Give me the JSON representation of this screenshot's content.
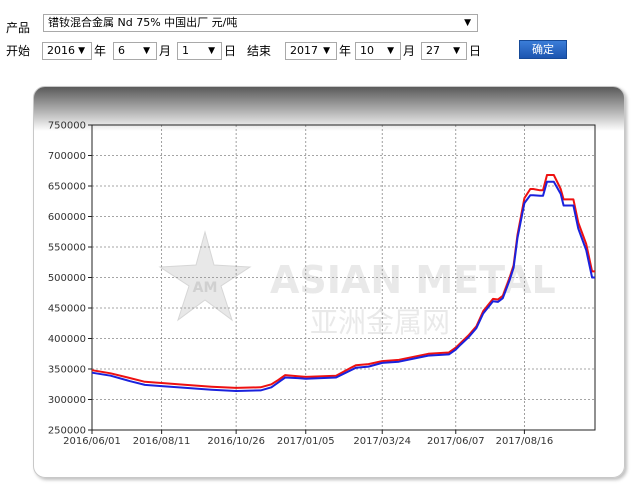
{
  "form": {
    "product_label": "产品",
    "product_value": "镨钕混合金属  Nd 75% 中国出厂  元/吨",
    "start_label": "开始",
    "start_year": "2016",
    "year_unit": "年",
    "start_month": "6",
    "month_unit": "月",
    "start_day": "1",
    "day_unit": "日",
    "end_label": "结束",
    "end_year": "2017",
    "end_month": "10",
    "end_day": "27",
    "confirm_button": "确定"
  },
  "watermark": {
    "logo_text": "AM",
    "brand_en": "ASIAN METAL",
    "brand_cn": "亚洲金属网"
  },
  "colors": {
    "series_red": "#ee1111",
    "series_blue": "#1a22dd",
    "button": "#2563c4"
  },
  "chart_data": {
    "type": "line",
    "ylim": [
      250000,
      750000
    ],
    "yticks": [
      250000,
      300000,
      350000,
      400000,
      450000,
      500000,
      550000,
      600000,
      650000,
      700000,
      750000
    ],
    "yticklabels": [
      "250000",
      "300000",
      "350000",
      "400000",
      "450000",
      "500000",
      "550000",
      "600000",
      "650000",
      "700000",
      "750000"
    ],
    "xlim": [
      "2016-06-01",
      "2017-10-27"
    ],
    "xticks": [
      "2016-06-01",
      "2016-08-11",
      "2016-10-26",
      "2017-01-05",
      "2017-03-24",
      "2017-06-07",
      "2017-08-16"
    ],
    "xticklabels": [
      "2016/06/01",
      "2016/08/11",
      "2016/10/26",
      "2017/01/05",
      "2017/03/24",
      "2017/06/07",
      "2017/08/16"
    ],
    "grid": true,
    "legend": "none",
    "series": [
      {
        "color": "#ee1111",
        "x": [
          "2016-06-01",
          "2016-06-20",
          "2016-07-10",
          "2016-07-25",
          "2016-08-11",
          "2016-09-05",
          "2016-10-01",
          "2016-10-26",
          "2016-11-20",
          "2016-12-01",
          "2016-12-08",
          "2016-12-15",
          "2016-12-28",
          "2017-01-05",
          "2017-02-05",
          "2017-02-20",
          "2017-02-25",
          "2017-03-10",
          "2017-03-24",
          "2017-04-10",
          "2017-04-25",
          "2017-05-10",
          "2017-05-31",
          "2017-06-07",
          "2017-06-12",
          "2017-06-20",
          "2017-06-28",
          "2017-07-05",
          "2017-07-15",
          "2017-07-20",
          "2017-07-25",
          "2017-08-01",
          "2017-08-05",
          "2017-08-09",
          "2017-08-16",
          "2017-08-22",
          "2017-08-25",
          "2017-09-01",
          "2017-09-04",
          "2017-09-08",
          "2017-09-15",
          "2017-09-22",
          "2017-09-25",
          "2017-10-05",
          "2017-10-10",
          "2017-10-18",
          "2017-10-24",
          "2017-10-27"
        ],
        "y": [
          348000,
          343000,
          335000,
          329000,
          327000,
          324000,
          321000,
          319000,
          320000,
          325000,
          332000,
          340000,
          338000,
          337000,
          339000,
          352000,
          356000,
          358000,
          363000,
          365000,
          370000,
          375000,
          377000,
          385000,
          393000,
          405000,
          420000,
          445000,
          465000,
          464000,
          470000,
          500000,
          520000,
          570000,
          630000,
          645000,
          645000,
          643000,
          643000,
          668000,
          668000,
          645000,
          628000,
          628000,
          590000,
          555000,
          510000,
          510000
        ]
      },
      {
        "color": "#1a22dd",
        "x": [
          "2016-06-01",
          "2016-06-20",
          "2016-07-10",
          "2016-07-25",
          "2016-08-11",
          "2016-09-05",
          "2016-10-01",
          "2016-10-26",
          "2016-11-20",
          "2016-12-01",
          "2016-12-08",
          "2016-12-15",
          "2016-12-28",
          "2017-01-05",
          "2017-02-05",
          "2017-02-20",
          "2017-02-25",
          "2017-03-10",
          "2017-03-24",
          "2017-04-10",
          "2017-04-25",
          "2017-05-10",
          "2017-05-31",
          "2017-06-07",
          "2017-06-12",
          "2017-06-20",
          "2017-06-28",
          "2017-07-05",
          "2017-07-15",
          "2017-07-20",
          "2017-07-25",
          "2017-08-01",
          "2017-08-05",
          "2017-08-09",
          "2017-08-16",
          "2017-08-22",
          "2017-08-25",
          "2017-09-01",
          "2017-09-04",
          "2017-09-08",
          "2017-09-15",
          "2017-09-22",
          "2017-09-25",
          "2017-10-05",
          "2017-10-10",
          "2017-10-18",
          "2017-10-24",
          "2017-10-27"
        ],
        "y": [
          344000,
          339000,
          330000,
          324000,
          322000,
          319000,
          316000,
          314000,
          315000,
          320000,
          328000,
          336000,
          335000,
          334000,
          336000,
          348000,
          352000,
          354000,
          360000,
          362000,
          367000,
          372000,
          374000,
          382000,
          390000,
          402000,
          417000,
          441000,
          461000,
          460000,
          466000,
          496000,
          516000,
          565000,
          622000,
          635000,
          635000,
          634000,
          634000,
          657000,
          657000,
          637000,
          618000,
          618000,
          580000,
          545000,
          500000,
          500000
        ]
      }
    ]
  }
}
